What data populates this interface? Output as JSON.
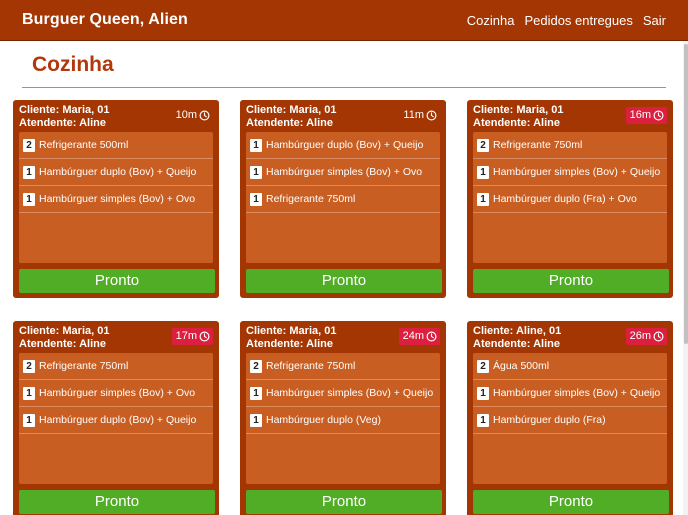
{
  "navbar": {
    "brand": "Burguer Queen, Alien",
    "links": [
      "Cozinha",
      "Pedidos entregues",
      "Sair"
    ]
  },
  "page": {
    "title": "Cozinha"
  },
  "colors": {
    "navbar": "#a33603",
    "card": "#a33603",
    "items_panel": "#c95e22",
    "ready_button": "#50ad25",
    "late_badge": "#dc1f3e",
    "title": "#b2380b"
  },
  "orders": [
    {
      "client": "Cliente: Maria, 01",
      "attendant": "Atendente: Aline",
      "time": "10m",
      "late": false,
      "items": [
        {
          "qty": "2",
          "name": "Refrigerante 500ml"
        },
        {
          "qty": "1",
          "name": "Hambúrguer duplo (Bov) + Queijo"
        },
        {
          "qty": "1",
          "name": "Hambúrguer simples (Bov) + Ovo"
        }
      ],
      "button": "Pronto"
    },
    {
      "client": "Cliente: Maria, 01",
      "attendant": "Atendente: Aline",
      "time": "11m",
      "late": false,
      "items": [
        {
          "qty": "1",
          "name": "Hambúrguer duplo (Bov) + Queijo"
        },
        {
          "qty": "1",
          "name": "Hambúrguer simples (Bov) + Ovo"
        },
        {
          "qty": "1",
          "name": "Refrigerante 750ml"
        }
      ],
      "button": "Pronto"
    },
    {
      "client": "Cliente: Maria, 01",
      "attendant": "Atendente: Aline",
      "time": "16m",
      "late": true,
      "items": [
        {
          "qty": "2",
          "name": "Refrigerante 750ml"
        },
        {
          "qty": "1",
          "name": "Hambúrguer simples (Bov) + Queijo"
        },
        {
          "qty": "1",
          "name": "Hambúrguer duplo (Fra) + Ovo"
        }
      ],
      "button": "Pronto"
    },
    {
      "client": "Cliente: Maria, 01",
      "attendant": "Atendente: Aline",
      "time": "17m",
      "late": true,
      "items": [
        {
          "qty": "2",
          "name": "Refrigerante 750ml"
        },
        {
          "qty": "1",
          "name": "Hambúrguer simples (Bov) + Ovo"
        },
        {
          "qty": "1",
          "name": "Hambúrguer duplo (Bov) + Queijo"
        }
      ],
      "button": "Pronto"
    },
    {
      "client": "Cliente: Maria, 01",
      "attendant": "Atendente: Aline",
      "time": "24m",
      "late": true,
      "items": [
        {
          "qty": "2",
          "name": "Refrigerante 750ml"
        },
        {
          "qty": "1",
          "name": "Hambúrguer simples (Bov) + Queijo"
        },
        {
          "qty": "1",
          "name": "Hambúrguer duplo (Veg)"
        }
      ],
      "button": "Pronto"
    },
    {
      "client": "Cliente: Aline, 01",
      "attendant": "Atendente: Aline",
      "time": "26m",
      "late": true,
      "items": [
        {
          "qty": "2",
          "name": "Água 500ml"
        },
        {
          "qty": "1",
          "name": "Hambúrguer simples (Bov) + Queijo"
        },
        {
          "qty": "1",
          "name": "Hambúrguer duplo (Fra)"
        }
      ],
      "button": "Pronto"
    }
  ]
}
